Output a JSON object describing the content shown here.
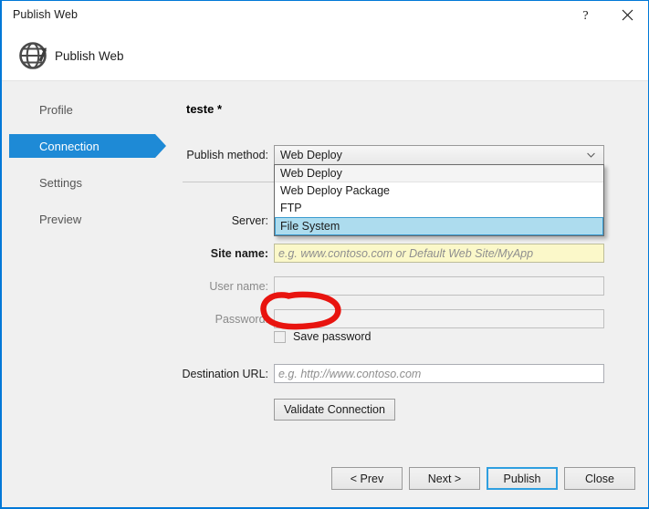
{
  "window": {
    "title": "Publish Web",
    "help_icon": "question-mark-icon",
    "close_icon": "close-icon"
  },
  "banner": {
    "icon": "globe-publish-icon",
    "title": "Publish Web"
  },
  "sidebar": {
    "items": [
      {
        "label": "Profile",
        "selected": false
      },
      {
        "label": "Connection",
        "selected": true
      },
      {
        "label": "Settings",
        "selected": false
      },
      {
        "label": "Preview",
        "selected": false
      }
    ]
  },
  "main": {
    "profile_name": "teste *",
    "publish_method": {
      "label": "Publish method:",
      "selected": "Web Deploy",
      "expanded": true,
      "chevron_icon": "chevron-down-icon",
      "options": [
        {
          "label": "Web Deploy",
          "state": "current"
        },
        {
          "label": "Web Deploy Package",
          "state": "normal"
        },
        {
          "label": "FTP",
          "state": "normal"
        },
        {
          "label": "File System",
          "state": "highlighted"
        }
      ]
    },
    "fields": [
      {
        "name": "server",
        "label": "Server:",
        "value": "",
        "placeholder": "",
        "disabled": false,
        "required": false
      },
      {
        "name": "site-name",
        "label": "Site name:",
        "value": "",
        "placeholder": "e.g. www.contoso.com or Default Web Site/MyApp",
        "disabled": false,
        "required": true
      },
      {
        "name": "user-name",
        "label": "User name:",
        "value": "",
        "placeholder": "",
        "disabled": true,
        "required": false
      },
      {
        "name": "password",
        "label": "Password:",
        "value": "",
        "placeholder": "",
        "disabled": true,
        "required": false
      },
      {
        "name": "destination-url",
        "label": "Destination URL:",
        "value": "",
        "placeholder": "e.g. http://www.contoso.com",
        "disabled": false,
        "required": false
      }
    ],
    "save_password": {
      "label": "Save password",
      "checked": false
    },
    "validate_connection_label": "Validate Connection"
  },
  "footer": {
    "buttons": [
      {
        "label": "< Prev",
        "default": false
      },
      {
        "label": "Next >",
        "default": false
      },
      {
        "label": "Publish",
        "default": true
      },
      {
        "label": "Close",
        "default": false
      }
    ]
  },
  "annotation": {
    "type": "hand-drawn-red-oval",
    "target": "File System",
    "color": "#e8140f"
  },
  "colors": {
    "accent": "#1e8ad6",
    "window_border": "#0078d7",
    "highlight": "#addcee",
    "required_field": "#fbf8c9",
    "annotation_red": "#e8140f",
    "body_background": "#f0f0f0"
  }
}
